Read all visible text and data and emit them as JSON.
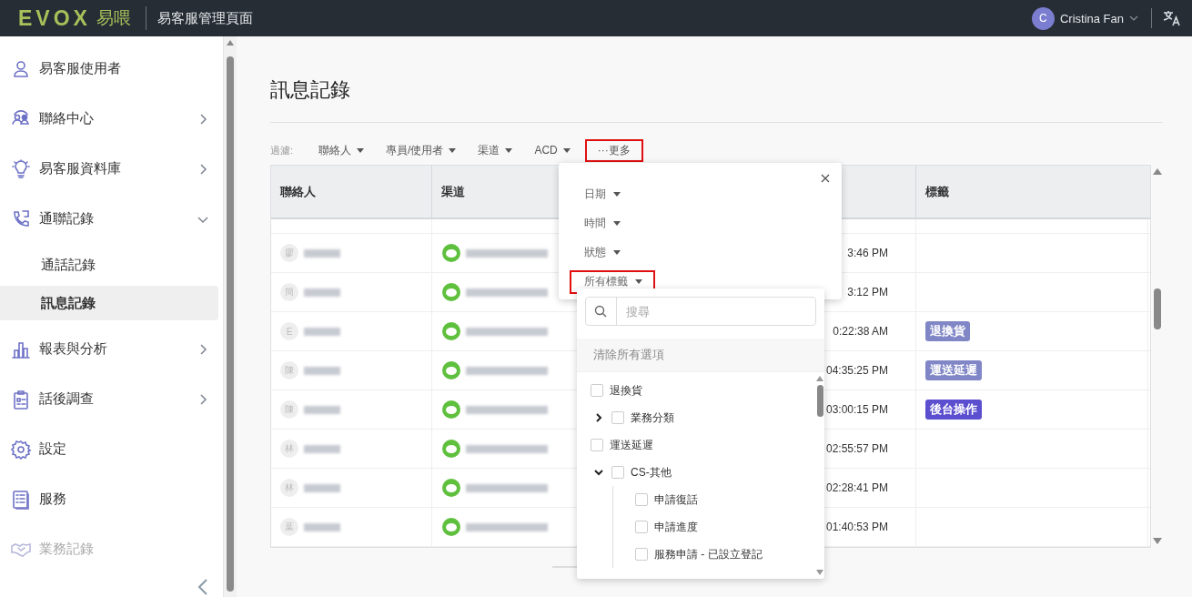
{
  "header": {
    "logo": "EVOX",
    "logo_suffix": "易喂",
    "title": "易客服管理頁面",
    "user": {
      "initial": "C",
      "name": "Cristina Fan"
    }
  },
  "sidebar": {
    "items": [
      {
        "label": "易客服使用者",
        "selected": false,
        "disabled": false
      },
      {
        "label": "聯絡中心",
        "selected": false,
        "disabled": false,
        "expanded": false
      },
      {
        "label": "易客服資料庫",
        "selected": false,
        "disabled": false,
        "expanded": false
      },
      {
        "label": "通聯記錄",
        "selected": false,
        "disabled": false,
        "expanded": true,
        "children": [
          {
            "label": "通話記錄",
            "selected": false
          },
          {
            "label": "訊息記錄",
            "selected": true
          }
        ]
      },
      {
        "label": "報表與分析",
        "selected": false,
        "disabled": false,
        "expanded": false
      },
      {
        "label": "話後調查",
        "selected": false,
        "disabled": false,
        "expanded": false
      },
      {
        "label": "設定",
        "selected": false,
        "disabled": false
      },
      {
        "label": "服務",
        "selected": false,
        "disabled": false
      },
      {
        "label": "業務記錄",
        "selected": false,
        "disabled": true
      }
    ]
  },
  "page": {
    "title": "訊息記錄"
  },
  "filters": {
    "label": "過濾:",
    "items": [
      {
        "label": "聯絡人",
        "highlighted": false
      },
      {
        "label": "專員/使用者",
        "highlighted": false
      },
      {
        "label": "渠道",
        "highlighted": false
      },
      {
        "label": "ACD",
        "highlighted": false
      }
    ],
    "more": {
      "icon": "···",
      "label": "更多",
      "highlighted": true
    }
  },
  "table": {
    "columns": [
      "聯絡人",
      "渠道",
      "",
      "標籤"
    ],
    "rows": [
      {
        "initial": "廖",
        "time": "3:46 PM",
        "tags": []
      },
      {
        "initial": "簡",
        "time": "3:12 PM",
        "tags": []
      },
      {
        "initial": "E",
        "time": "0:22:38 AM",
        "tags": [
          {
            "label": "退換貨",
            "color": "#8187c6"
          }
        ]
      },
      {
        "initial": "陳",
        "time": "04:35:25 PM",
        "tags": [
          {
            "label": "運送延遲",
            "color": "#8187c6"
          }
        ]
      },
      {
        "initial": "陳",
        "time": "03:00:15 PM",
        "tags": [
          {
            "label": "後台操作",
            "color": "#5b4fcf"
          }
        ]
      },
      {
        "initial": "林",
        "time": "02:55:57 PM",
        "tags": []
      },
      {
        "initial": "林",
        "time": "02:28:41 PM",
        "tags": []
      },
      {
        "initial": "葉",
        "time": "01:40:53 PM",
        "tags": []
      }
    ]
  },
  "more_popover": {
    "items": [
      {
        "label": "日期",
        "highlighted": false
      },
      {
        "label": "時間",
        "highlighted": false
      },
      {
        "label": "狀態",
        "highlighted": false
      },
      {
        "label": "所有標籤",
        "highlighted": true
      }
    ]
  },
  "tag_dropdown": {
    "search": {
      "placeholder": "搜尋"
    },
    "clear": "清除所有選項",
    "items": [
      {
        "label": "退換貨",
        "checked": false
      },
      {
        "label": "業務分類",
        "checked": false,
        "expanded": false
      },
      {
        "label": "運送延遲",
        "checked": false
      },
      {
        "label": "CS-其他",
        "checked": false,
        "expanded": true,
        "children": [
          {
            "label": "申請復話",
            "checked": false
          },
          {
            "label": "申請進度",
            "checked": false
          },
          {
            "label": "服務申請 - 已設立登記",
            "checked": false
          }
        ]
      }
    ]
  }
}
